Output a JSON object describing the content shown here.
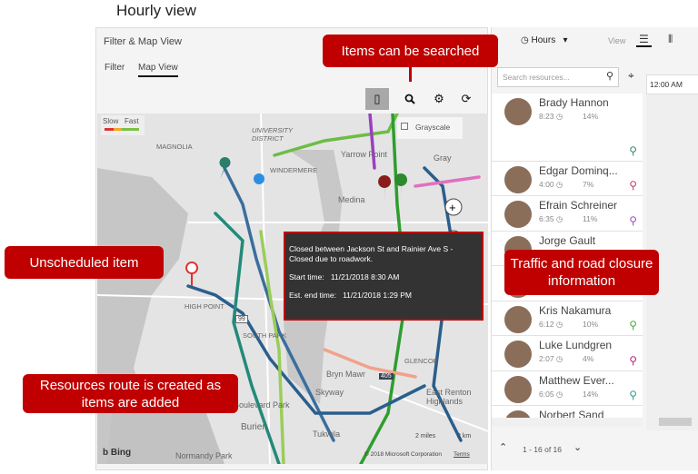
{
  "page_title": "Hourly view",
  "left_panel": {
    "title": "Filter & Map View",
    "tabs": [
      {
        "label": "Filter"
      },
      {
        "label": "Map View",
        "active": true
      }
    ],
    "toolbar": {
      "traffic": "traffic-light-icon",
      "search": "search-icon",
      "settings": "gear-icon",
      "refresh": "refresh-icon"
    },
    "map": {
      "legend": {
        "slow": "Slow",
        "fast": "Fast"
      },
      "grayscale_label": "Grayscale",
      "labels": [
        "MAGNOLIA",
        "UNIVERSITY DISTRICT",
        "WINDERMERE",
        "Yarrow Point",
        "Medina",
        "Gray",
        "HIGH POINT",
        "SOUTH PARK",
        "Bryn Mawr",
        "Skyway",
        "GLENCOE",
        "East Renton Highlands",
        "Boulevard Park",
        "Burien",
        "Tukwila",
        "Normandy Park"
      ],
      "highway_shields": [
        "99",
        "405"
      ],
      "scale": {
        "miles": "2 miles",
        "km": "2 km"
      },
      "copyright": "© 2018 Microsoft Corporation",
      "terms": "Terms",
      "bing": "Bing"
    },
    "tooltip": {
      "line1": "Closed between Jackson St and Rainier Ave S -",
      "line2": "Closed due to roadwork.",
      "start_label": "Start time:",
      "start_value": "11/21/2018 8:30 AM",
      "end_label": "Est. end time:",
      "end_value": "11/21/2018 1:29 PM"
    }
  },
  "right_panel": {
    "toolbar": {
      "hours": "Hours",
      "view": "View"
    },
    "search_placeholder": "Search resources...",
    "timeline_header": "12:00 AM",
    "resources": [
      {
        "name": "Brady Hannon",
        "time": "8:23",
        "pct": "14%",
        "pin_color": "#3a8a70"
      },
      {
        "name": "Edgar Dominq...",
        "time": "4:00",
        "pct": "7%",
        "pin_color": "#c04070"
      },
      {
        "name": "Efrain Schreiner",
        "time": "6:35",
        "pct": "11%",
        "pin_color": "#a050c0"
      },
      {
        "name": "Jorge Gault"
      },
      {
        "name": ""
      },
      {
        "name": "Kris Nakamura",
        "time": "6:12",
        "pct": "10%",
        "pin_color": "#40b040"
      },
      {
        "name": "Luke Lundgren",
        "time": "2:07",
        "pct": "4%",
        "pin_color": "#c02080"
      },
      {
        "name": "Matthew Ever...",
        "time": "6:05",
        "pct": "14%",
        "pin_color": "#30a090"
      },
      {
        "name": "Norbert Sand"
      }
    ],
    "pagination": "1 - 16 of 16"
  },
  "callouts": {
    "search": "Items can be searched",
    "unscheduled": "Unscheduled item",
    "traffic": "Traffic and road closure information",
    "route": "Resources route is created as items are added"
  },
  "colors": {
    "callout": "#c00000",
    "accent_dark": "#333333"
  }
}
